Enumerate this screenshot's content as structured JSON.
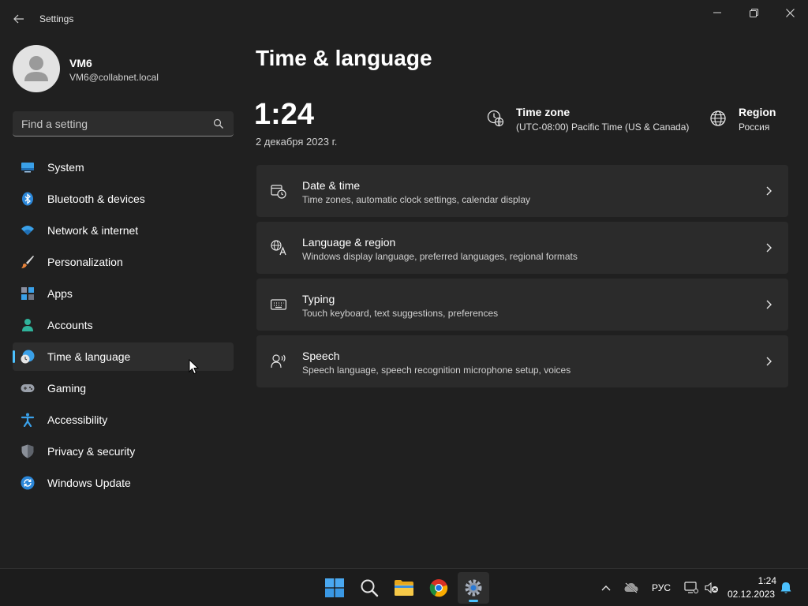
{
  "window": {
    "title": "Settings"
  },
  "profile": {
    "name": "VM6",
    "email": "VM6@collabnet.local"
  },
  "search": {
    "placeholder": "Find a setting"
  },
  "nav": {
    "items": [
      {
        "label": "System",
        "icon": "system-icon"
      },
      {
        "label": "Bluetooth & devices",
        "icon": "bluetooth-icon"
      },
      {
        "label": "Network & internet",
        "icon": "wifi-icon"
      },
      {
        "label": "Personalization",
        "icon": "brush-icon"
      },
      {
        "label": "Apps",
        "icon": "apps-icon"
      },
      {
        "label": "Accounts",
        "icon": "account-icon"
      },
      {
        "label": "Time & language",
        "icon": "time-language-icon",
        "selected": true
      },
      {
        "label": "Gaming",
        "icon": "gamepad-icon"
      },
      {
        "label": "Accessibility",
        "icon": "accessibility-icon"
      },
      {
        "label": "Privacy & security",
        "icon": "shield-icon"
      },
      {
        "label": "Windows Update",
        "icon": "update-icon"
      }
    ]
  },
  "main": {
    "title": "Time & language",
    "time": "1:24",
    "date": "2 декабря 2023 г.",
    "timezone": {
      "label": "Time zone",
      "value": "(UTC-08:00) Pacific Time (US & Canada)"
    },
    "region": {
      "label": "Region",
      "value": "Россия"
    },
    "cards": [
      {
        "title": "Date & time",
        "desc": "Time zones, automatic clock settings, calendar display",
        "icon": "calendar-clock-icon"
      },
      {
        "title": "Language & region",
        "desc": "Windows display language, preferred languages, regional formats",
        "icon": "language-icon"
      },
      {
        "title": "Typing",
        "desc": "Touch keyboard, text suggestions, preferences",
        "icon": "keyboard-icon"
      },
      {
        "title": "Speech",
        "desc": "Speech language, speech recognition microphone setup, voices",
        "icon": "speech-icon"
      }
    ]
  },
  "taskbar": {
    "language": "РУС",
    "time": "1:24",
    "date": "02.12.2023"
  },
  "colors": {
    "accent": "#4cc2ff",
    "background": "#202020",
    "card": "#2b2b2b"
  }
}
